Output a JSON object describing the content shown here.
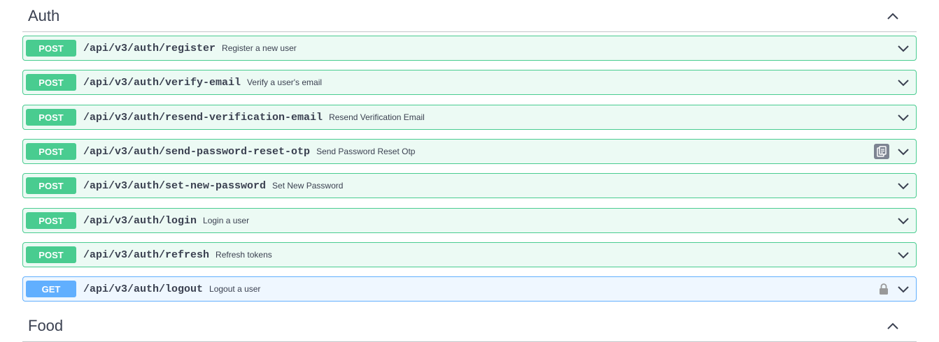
{
  "sections": [
    {
      "title": "Auth",
      "toggle_icon": "chevron-up-icon"
    },
    {
      "title": "Food",
      "toggle_icon": "chevron-up-icon"
    }
  ],
  "operations": [
    {
      "method": "POST",
      "path": "/api/v3/auth/register",
      "summary": "Register a new user"
    },
    {
      "method": "POST",
      "path": "/api/v3/auth/verify-email",
      "summary": "Verify a user's email"
    },
    {
      "method": "POST",
      "path": "/api/v3/auth/resend-verification-email",
      "summary": "Resend Verification Email"
    },
    {
      "method": "POST",
      "path": "/api/v3/auth/send-password-reset-otp",
      "summary": "Send Password Reset Otp",
      "extra_icon": "copy-to-clipboard-icon"
    },
    {
      "method": "POST",
      "path": "/api/v3/auth/set-new-password",
      "summary": "Set New Password"
    },
    {
      "method": "POST",
      "path": "/api/v3/auth/login",
      "summary": "Login a user"
    },
    {
      "method": "POST",
      "path": "/api/v3/auth/refresh",
      "summary": "Refresh tokens"
    },
    {
      "method": "GET",
      "path": "/api/v3/auth/logout",
      "summary": "Logout a user",
      "extra_icon": "lock-icon"
    }
  ],
  "colors": {
    "post": "#49cc90",
    "get": "#61affe",
    "text": "#3b4151"
  }
}
